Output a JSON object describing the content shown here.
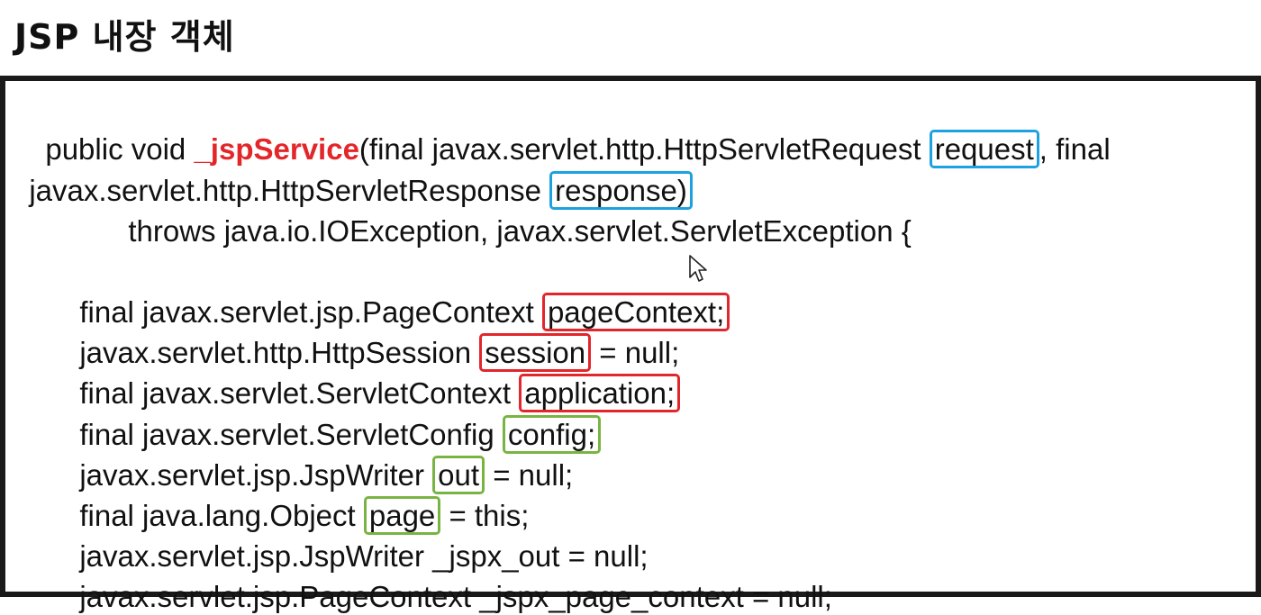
{
  "title": "JSP 내장 객체",
  "code": {
    "l1": {
      "pre": "public void ",
      "fn": "_jspService",
      "mid": "(final javax.servlet.http.HttpServletRequest ",
      "hl": "request",
      "post": ", final"
    },
    "l2": {
      "pre": "javax.servlet.http.HttpServletResponse ",
      "hl": "response)",
      "post": ""
    },
    "l3": {
      "text": "throws java.io.IOException, javax.servlet.ServletException {"
    },
    "l4": {
      "pre": "final javax.servlet.jsp.PageContext ",
      "hl": "pageContext;",
      "post": ""
    },
    "l5": {
      "pre": "javax.servlet.http.HttpSession ",
      "hl": "session",
      "post": " = null;"
    },
    "l6": {
      "pre": "final javax.servlet.ServletContext ",
      "hl": "application;",
      "post": ""
    },
    "l7": {
      "pre": "final javax.servlet.ServletConfig ",
      "hl": "config;",
      "post": ""
    },
    "l8": {
      "pre": "javax.servlet.jsp.JspWriter ",
      "hl": "out",
      "post": " = null;"
    },
    "l9": {
      "pre": "final java.lang.Object ",
      "hl": "page",
      "post": " = this;"
    },
    "l10": {
      "text": "javax.servlet.jsp.JspWriter _jspx_out = null;"
    },
    "l11": {
      "text": "javax.servlet.jsp.PageContext _jspx_page_context = null;"
    }
  },
  "colors": {
    "blue_highlight": "#1da1e0",
    "red_highlight": "#e3262a",
    "green_highlight": "#79b443"
  }
}
